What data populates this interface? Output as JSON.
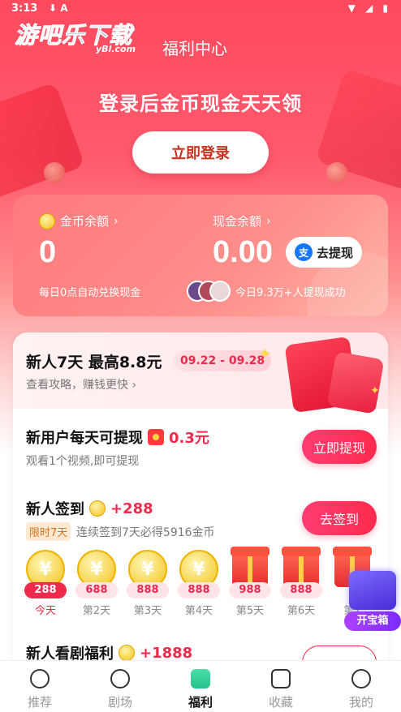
{
  "status_bar": {
    "time": "3:13",
    "icons": "⬇ A",
    "right_icons": "▼ ◢ ▮"
  },
  "brand": {
    "logo_text": "游吧乐下载",
    "logo_sub": "yBl.com"
  },
  "header": {
    "title": "福利中心"
  },
  "hero": {
    "headline": "登录后金币现金天天领",
    "login_button": "立即登录"
  },
  "balance": {
    "coin_label": "金币余额",
    "coin_value": "0",
    "coin_note": "每日0点自动兑换现金",
    "cash_label": "现金余额",
    "cash_value": "0.00",
    "withdraw_button": "去提现",
    "withdraw_note": "今日9.3万+人提现成功",
    "alipay_glyph": "支"
  },
  "newbie": {
    "title": "新人7天 最高8.8元",
    "date_range": "09.22 - 09.28",
    "subtitle": "查看攻略，赚钱更快",
    "withdraw_task": {
      "title": "新用户每天可提现",
      "amount": "0.3元",
      "subtitle": "观看1个视频,即可提现",
      "button": "立即提现"
    },
    "checkin": {
      "title": "新人签到",
      "reward": "+288",
      "tag": "限时7天",
      "subtitle": "连续签到7天必得5916金币",
      "button": "去签到",
      "coin_glyph": "¥",
      "days": [
        {
          "amount": "288",
          "label": "今天",
          "type": "coin",
          "active": true
        },
        {
          "amount": "688",
          "label": "第2天",
          "type": "coin",
          "active": false
        },
        {
          "amount": "888",
          "label": "第3天",
          "type": "coin",
          "active": false
        },
        {
          "amount": "888",
          "label": "第4天",
          "type": "coin",
          "active": false
        },
        {
          "amount": "988",
          "label": "第5天",
          "type": "gift",
          "active": false
        },
        {
          "amount": "888",
          "label": "第6天",
          "type": "gift",
          "active": false
        },
        {
          "amount": "",
          "label": "第7",
          "type": "gift",
          "active": false
        }
      ]
    },
    "drama": {
      "title": "新人看剧福利",
      "reward": "+1888"
    }
  },
  "treasure": {
    "label": "开宝箱"
  },
  "tabs": [
    {
      "label": "推荐",
      "icon": "planet-icon",
      "active": false
    },
    {
      "label": "剧场",
      "icon": "film-reel-icon",
      "active": false
    },
    {
      "label": "福利",
      "icon": "gift-pet-icon",
      "active": true
    },
    {
      "label": "收藏",
      "icon": "bookmark-icon",
      "active": false
    },
    {
      "label": "我的",
      "icon": "profile-icon",
      "active": false
    }
  ],
  "colors": {
    "primary": "#ee2a4d",
    "hero": "#ff4a5e",
    "button_gradient": "#ff3d73"
  }
}
